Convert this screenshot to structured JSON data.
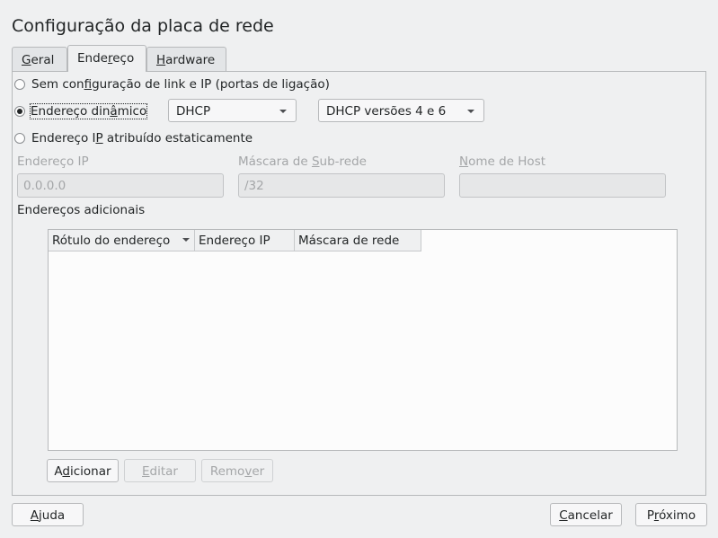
{
  "window": {
    "title": "Configuração da placa de rede"
  },
  "tabs": [
    {
      "pre": "",
      "u": "G",
      "post": "eral"
    },
    {
      "pre": "Ende",
      "u": "r",
      "post": "eço"
    },
    {
      "pre": "",
      "u": "H",
      "post": "ardware"
    }
  ],
  "address": {
    "radio_no_link": {
      "pre": "Sem con",
      "u": "f",
      "post": "iguração de link e IP (portas de ligação)"
    },
    "radio_dynamic": {
      "pre": "Endereço din",
      "u": "â",
      "post": "mico",
      "checked": true
    },
    "dhcp_mode": "DHCP",
    "dhcp_versions": "DHCP versões 4 e 6",
    "radio_static": {
      "pre": "Endereço I",
      "u": "P",
      "post": " atribuído estaticamente"
    },
    "ip_label": "Endereço IP",
    "ip_value": "0.0.0.0",
    "mask_label": {
      "pre": "Máscara de ",
      "u": "S",
      "post": "ub-rede"
    },
    "mask_value": "/32",
    "host_label": {
      "pre": "",
      "u": "N",
      "post": "ome de Host"
    },
    "host_value": "",
    "additional_label": "Endereços adicionais",
    "table_headers": [
      "Rótulo do endereço",
      "Endereço IP",
      "Máscara de rede"
    ],
    "table_rows": [],
    "add_button": {
      "pre": "A",
      "u": "d",
      "post": "icionar"
    },
    "edit_button": {
      "pre": "",
      "u": "E",
      "post": "ditar"
    },
    "remove_button": {
      "pre": "Remo",
      "u": "v",
      "post": "er"
    }
  },
  "footer": {
    "help": {
      "pre": "",
      "u": "A",
      "post": "juda"
    },
    "cancel": {
      "pre": "",
      "u": "C",
      "post": "ancelar"
    },
    "next": {
      "pre": "P",
      "u": "r",
      "post": "óximo"
    }
  }
}
